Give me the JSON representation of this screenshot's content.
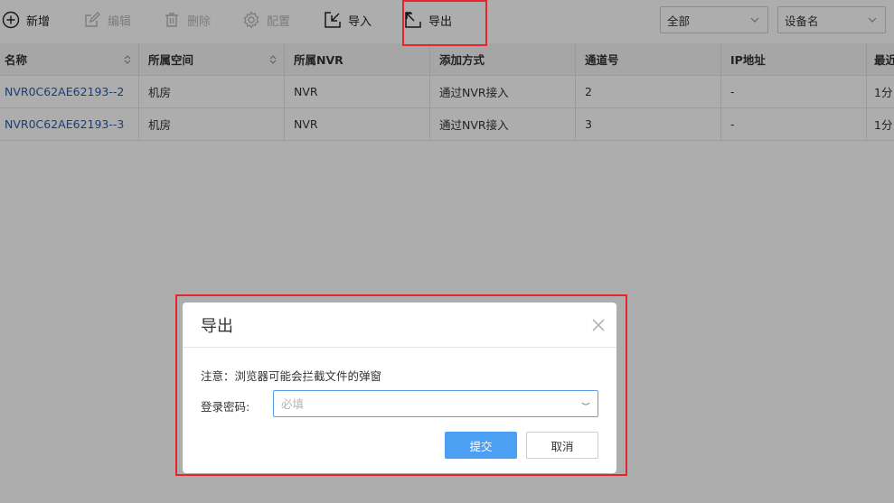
{
  "toolbar": {
    "add": "新增",
    "edit": "编辑",
    "delete": "删除",
    "config": "配置",
    "import": "导入",
    "export": "导出",
    "filter_scope": "全部",
    "filter_field": "设备名"
  },
  "table": {
    "headers": [
      "名称",
      "所属空间",
      "所属NVR",
      "添加方式",
      "通道号",
      "IP地址",
      "最近"
    ],
    "rows": [
      [
        "NVR0C62AE62193--2",
        "机房",
        "NVR",
        "通过NVR接入",
        "2",
        "-",
        "1分"
      ],
      [
        "NVR0C62AE62193--3",
        "机房",
        "NVR",
        "通过NVR接入",
        "3",
        "-",
        "1分"
      ]
    ]
  },
  "dialog": {
    "title": "导出",
    "notice": "注意：浏览器可能会拦截文件的弹窗",
    "password_label": "登录密码:",
    "password_placeholder": "必填",
    "submit": "提交",
    "cancel": "取消"
  },
  "colors": {
    "highlight": "#e8252a",
    "primary": "#4d9ff3",
    "link": "#2b5aa8"
  }
}
